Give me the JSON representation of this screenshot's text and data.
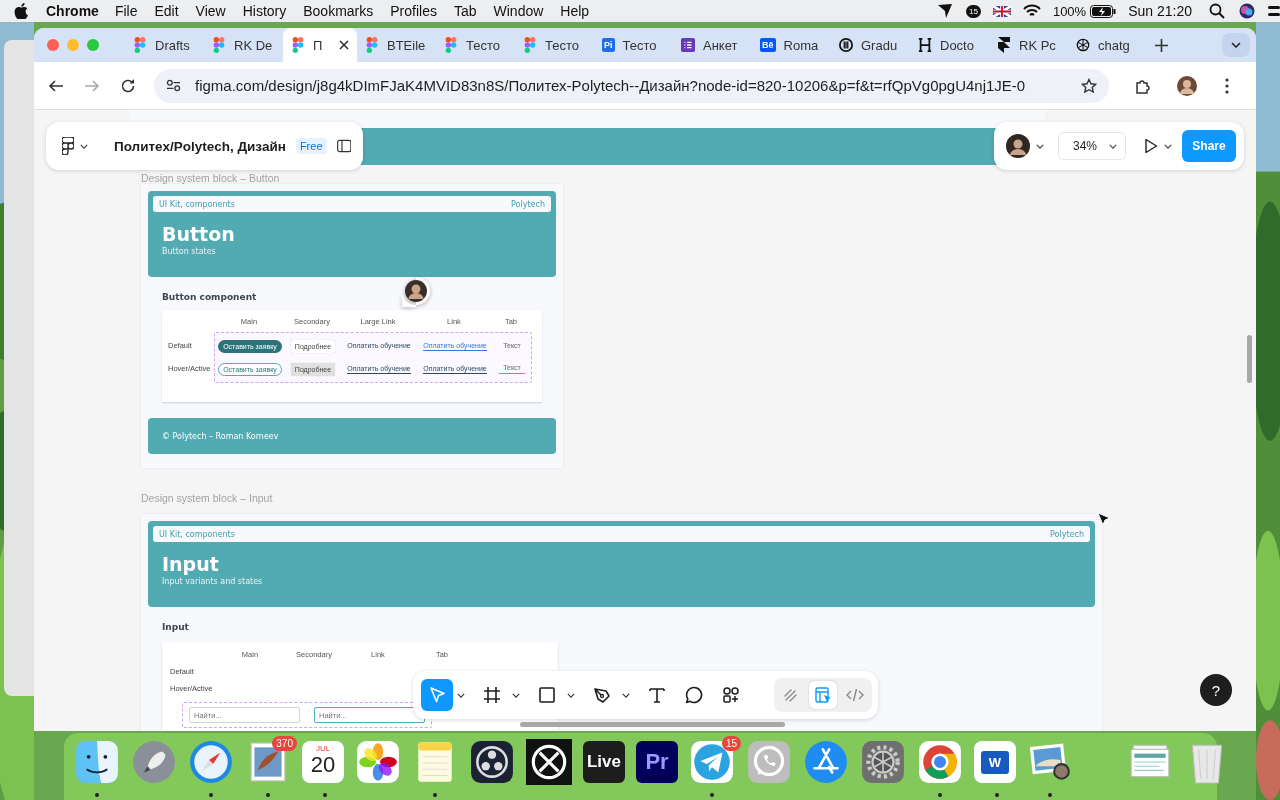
{
  "menu_bar": {
    "app": "Chrome",
    "menus": [
      "File",
      "Edit",
      "View",
      "History",
      "Bookmarks",
      "Profiles",
      "Tab",
      "Window",
      "Help"
    ],
    "status": [
      {
        "kind": "arrow"
      },
      {
        "kind": "counter",
        "text": "15"
      },
      {
        "kind": "flag"
      },
      {
        "kind": "wifi"
      },
      {
        "kind": "battery-text",
        "text": "100%"
      },
      {
        "kind": "battery"
      },
      {
        "kind": "clock",
        "text": "Sun 21:20"
      },
      {
        "kind": "search"
      },
      {
        "kind": "siri"
      },
      {
        "kind": "control-center"
      }
    ]
  },
  "browser": {
    "tabs": [
      {
        "title": "Drafts",
        "kind": "figma",
        "selected": false
      },
      {
        "title": "RK De",
        "kind": "figma",
        "selected": false
      },
      {
        "title": "П",
        "kind": "figma",
        "selected": true
      },
      {
        "title": "BTEile",
        "kind": "figma",
        "selected": false
      },
      {
        "title": "Тесто",
        "kind": "figma",
        "selected": false
      },
      {
        "title": "Тесто",
        "kind": "figma",
        "selected": false
      },
      {
        "title": "Тесто",
        "kind": "pi",
        "icon_text": "Pi",
        "selected": false
      },
      {
        "title": "Анкет",
        "kind": "list",
        "selected": false
      },
      {
        "title": "Roma",
        "kind": "behance",
        "icon_text": "Bē",
        "selected": false
      },
      {
        "title": "Gradu",
        "kind": "ring",
        "selected": false
      },
      {
        "title": "Docto",
        "kind": "h",
        "selected": false
      },
      {
        "title": "RK Pc",
        "kind": "framer",
        "selected": false
      },
      {
        "title": "chatg",
        "kind": "knot",
        "selected": false
      }
    ],
    "address": "figma.com/design/j8g4kDImFJaK4MVID83n8S/Политех-Polytech--Дизайн?node-id=820-10206&p=f&t=rfQpVg0pgU4nj1JE-0"
  },
  "figma": {
    "file_name": "Политех/Polytech, Дизайн",
    "plan": "Free",
    "zoom": "34%",
    "share": "Share",
    "button_frame": {
      "label": "Design system block – Button",
      "kit": "UI Kit, components",
      "brand": "Polytech",
      "title": "Button",
      "subtitle": "Button states",
      "section": "Button component",
      "columns": [
        "Main",
        "Secondary",
        "Large Link",
        "Link",
        "Tab"
      ],
      "rows": [
        {
          "label": "Default",
          "hover": false,
          "cells": [
            {
              "kind": "main",
              "text": "Оставить заявку"
            },
            {
              "kind": "secondary",
              "text": "Подробнее"
            },
            {
              "kind": "large-link",
              "text": "Оплатить обучение"
            },
            {
              "kind": "link",
              "text": "Оплатить обучение"
            },
            {
              "kind": "tab",
              "text": "Текст"
            }
          ]
        },
        {
          "label": "Hover/Active",
          "hover": true,
          "cells": [
            {
              "kind": "main",
              "text": "Оставить заявку"
            },
            {
              "kind": "secondary",
              "text": "Подробнее"
            },
            {
              "kind": "large-link",
              "text": "Оплатить обучение"
            },
            {
              "kind": "link",
              "text": "Оплатить обучение"
            },
            {
              "kind": "tab",
              "text": "Текст"
            }
          ]
        }
      ],
      "footer": "© Polytech – Roman Korneev"
    },
    "input_frame": {
      "label": "Design system block – Input",
      "kit": "UI Kit, components",
      "brand": "Polytech",
      "title": "Input",
      "subtitle": "Input variants and states",
      "section": "Input",
      "columns": [
        "Main",
        "Secondary",
        "Link",
        "Tab"
      ],
      "rows": [
        "Default",
        "Hover/Active"
      ],
      "fields": [
        {
          "placeholder": "Найти...",
          "focused": false
        },
        {
          "placeholder": "Найти...",
          "focused": true
        }
      ]
    },
    "tools": [
      {
        "kind": "move",
        "selected": true,
        "menu": true
      },
      {
        "kind": "frame",
        "selected": false,
        "menu": true
      },
      {
        "kind": "shape",
        "selected": false,
        "menu": true
      },
      {
        "kind": "pen",
        "selected": false,
        "menu": true
      },
      {
        "kind": "text",
        "selected": false,
        "menu": false
      },
      {
        "kind": "comment",
        "selected": false,
        "menu": false
      },
      {
        "kind": "actions",
        "selected": false,
        "menu": false
      }
    ],
    "modes": [
      {
        "kind": "draw",
        "selected": false
      },
      {
        "kind": "design",
        "selected": true
      },
      {
        "kind": "dev",
        "selected": false
      }
    ],
    "help": "?"
  },
  "dock": [
    {
      "kind": "finder",
      "running": true
    },
    {
      "kind": "launchpad",
      "running": false
    },
    {
      "kind": "safari",
      "running": true
    },
    {
      "kind": "mail",
      "running": true,
      "badge": "370"
    },
    {
      "kind": "calendar",
      "running": true,
      "month": "JUL",
      "day": "20"
    },
    {
      "kind": "photos",
      "running": false
    },
    {
      "kind": "notes",
      "running": true
    },
    {
      "kind": "obs",
      "running": false
    },
    {
      "kind": "crossring",
      "running": false
    },
    {
      "kind": "live",
      "running": false,
      "label": "Live"
    },
    {
      "kind": "premiere",
      "running": false,
      "label": "Pr"
    },
    {
      "kind": "telegram",
      "running": true,
      "badge": "15"
    },
    {
      "kind": "whatsapp",
      "running": false
    },
    {
      "kind": "appstore",
      "running": false
    },
    {
      "kind": "settings",
      "running": false
    },
    {
      "kind": "chrome",
      "running": true
    },
    {
      "kind": "word",
      "running": true,
      "label": "W"
    },
    {
      "kind": "preview",
      "running": true
    },
    {
      "kind": "separator"
    },
    {
      "kind": "stack",
      "running": false
    },
    {
      "kind": "trash",
      "running": false
    }
  ]
}
